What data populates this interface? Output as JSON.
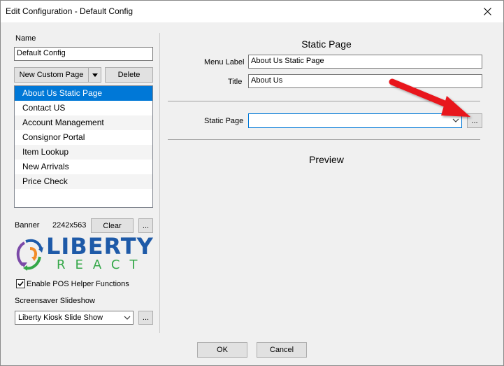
{
  "window": {
    "title": "Edit Configuration - Default Config",
    "close_glyph": "✕"
  },
  "left": {
    "name_label": "Name",
    "name_value": "Default Config",
    "new_page_button": "New Custom Page",
    "delete_button": "Delete",
    "pages": [
      "About Us Static Page",
      "Contact US",
      "Account Management",
      "Consignor Portal",
      "Item Lookup",
      "New Arrivals",
      "Price Check"
    ],
    "selected_page": 0,
    "banner_label": "Banner",
    "banner_size": "2242x563",
    "clear_button": "Clear",
    "ellipsis": "...",
    "logo": {
      "top": "LIBERTY",
      "bottom": "REACT",
      "primary_color": "#1e5aa8",
      "accent_color": "#35a849"
    },
    "pos_helper_label": "Enable POS Helper Functions",
    "pos_helper_checked": true,
    "screensaver_label": "Screensaver Slideshow",
    "screensaver_value": "Liberty Kiosk Slide Show"
  },
  "right": {
    "heading": "Static Page",
    "menu_label_label": "Menu Label",
    "menu_label_value": "About Us Static Page",
    "title_label": "Title",
    "title_value": "About Us",
    "static_page_label": "Static Page",
    "static_page_value": "",
    "browse_button": "...",
    "preview_label": "Preview"
  },
  "footer": {
    "ok_button": "OK",
    "cancel_button": "Cancel"
  },
  "annotation": {
    "arrow_color": "#e8141b"
  }
}
